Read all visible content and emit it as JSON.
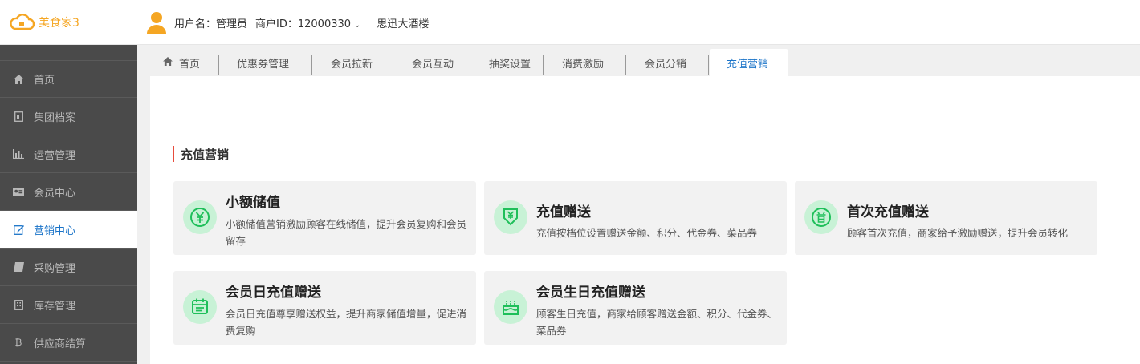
{
  "header": {
    "app_name": "美食家3",
    "username": "用户名：管理员",
    "merchant_id": "商户ID：12000330",
    "shop_name": "思迅大酒楼"
  },
  "sidebar": {
    "items": [
      {
        "label": "首页",
        "icon": "home-icon"
      },
      {
        "label": "集团档案",
        "icon": "file-icon"
      },
      {
        "label": "运营管理",
        "icon": "bar-chart-icon"
      },
      {
        "label": "会员中心",
        "icon": "id-card-icon"
      },
      {
        "label": "营销中心",
        "icon": "edit-icon",
        "active": true
      },
      {
        "label": "采购管理",
        "icon": "book-icon"
      },
      {
        "label": "库存管理",
        "icon": "building-icon"
      },
      {
        "label": "供应商结算",
        "icon": "bitcoin-icon"
      }
    ]
  },
  "tabs": [
    {
      "label": "首页",
      "icon": "home-icon"
    },
    {
      "label": "优惠券管理"
    },
    {
      "label": "会员拉新"
    },
    {
      "label": "会员互动"
    },
    {
      "label": "抽奖设置"
    },
    {
      "label": "消费激励"
    },
    {
      "label": "会员分销"
    },
    {
      "label": "充值营销",
      "active": true
    }
  ],
  "main": {
    "section_title": "充值营销",
    "cards": [
      {
        "title": "小额储值",
        "desc": "小额储值营销激励顾客在线储值，提升会员复购和会员留存",
        "icon": "yuan-coin-icon"
      },
      {
        "title": "充值赠送",
        "desc": "充值按档位设置赠送金额、积分、代金券、菜品券",
        "icon": "recharge-gift-icon"
      },
      {
        "title": "首次充值赠送",
        "desc": "顾客首次充值，商家给予激励赠送，提升会员转化",
        "icon": "first-badge-icon"
      },
      {
        "title": "会员日充值赠送",
        "desc": "会员日充值尊享赠送权益，提升商家储值增量，促进消费复购",
        "icon": "calendar-icon"
      },
      {
        "title": "会员生日充值赠送",
        "desc": "顾客生日充值，商家给顾客赠送金额、积分、代金券、菜品券",
        "icon": "birthday-cake-icon"
      }
    ]
  },
  "colors": {
    "accent": "#1a73c8",
    "sidebar_bg": "#4a4a4a",
    "logo": "#f5a623",
    "icon_green": "#1fbf5a",
    "icon_bg": "#c8f2d6",
    "section_bar": "#e74c3c"
  }
}
